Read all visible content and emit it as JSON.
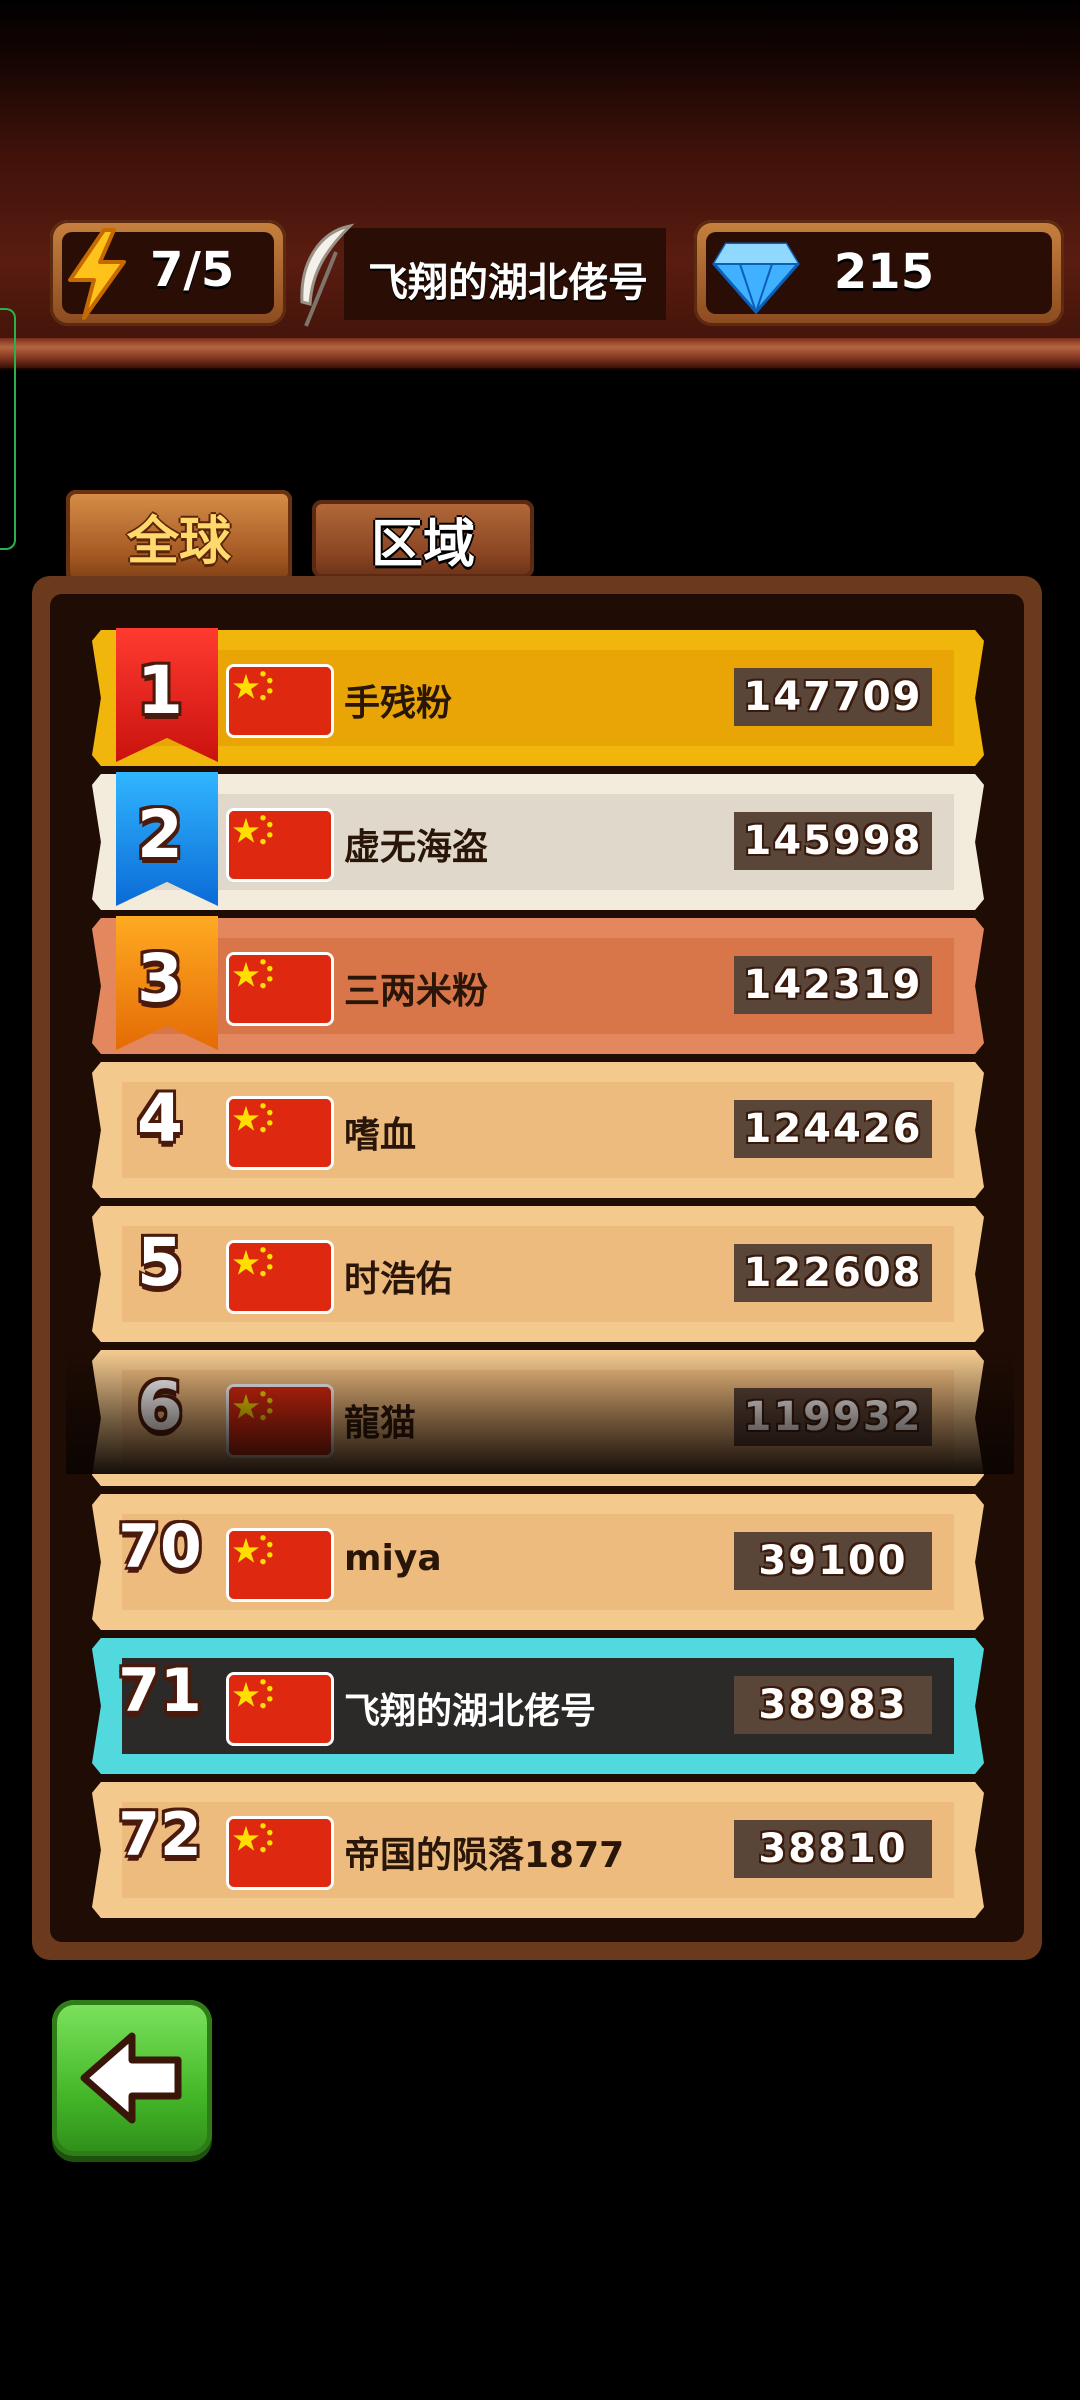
{
  "header": {
    "energy": "7/5",
    "player_name": "飞翔的湖北佬号",
    "gems": "215",
    "energy_icon": "lightning-bolt-icon",
    "name_icon": "feather-icon",
    "gem_icon": "diamond-icon"
  },
  "tabs": [
    {
      "label": "全球",
      "active": true
    },
    {
      "label": "区域",
      "active": false
    }
  ],
  "leaderboard": [
    {
      "rank": "1",
      "name": "手残粉",
      "score": "147709",
      "tier": "gold"
    },
    {
      "rank": "2",
      "name": "虚无海盗",
      "score": "145998",
      "tier": "silver"
    },
    {
      "rank": "3",
      "name": "三两米粉",
      "score": "142319",
      "tier": "bronze"
    },
    {
      "rank": "4",
      "name": "嗜血",
      "score": "124426",
      "tier": "plain"
    },
    {
      "rank": "5",
      "name": "时浩佑",
      "score": "122608",
      "tier": "plain"
    },
    {
      "rank": "6",
      "name": "龍猫",
      "score": "119932",
      "tier": "plain"
    },
    {
      "rank": "70",
      "name": "miya",
      "score": "39100",
      "tier": "plain"
    },
    {
      "rank": "71",
      "name": "飞翔的湖北佬号",
      "score": "38983",
      "tier": "me"
    },
    {
      "rank": "72",
      "name": "帝国的陨落1877",
      "score": "38810",
      "tier": "plain"
    }
  ],
  "flag_icon": "china-flag-icon",
  "back_button": {
    "icon": "back-arrow-icon"
  },
  "colors": {
    "gold": "#f0b60c",
    "silver": "#f3ecdd",
    "bronze": "#e2875e",
    "plain": "#f3c98e",
    "highlight": "#52d9de",
    "back_green": "#45b829"
  }
}
